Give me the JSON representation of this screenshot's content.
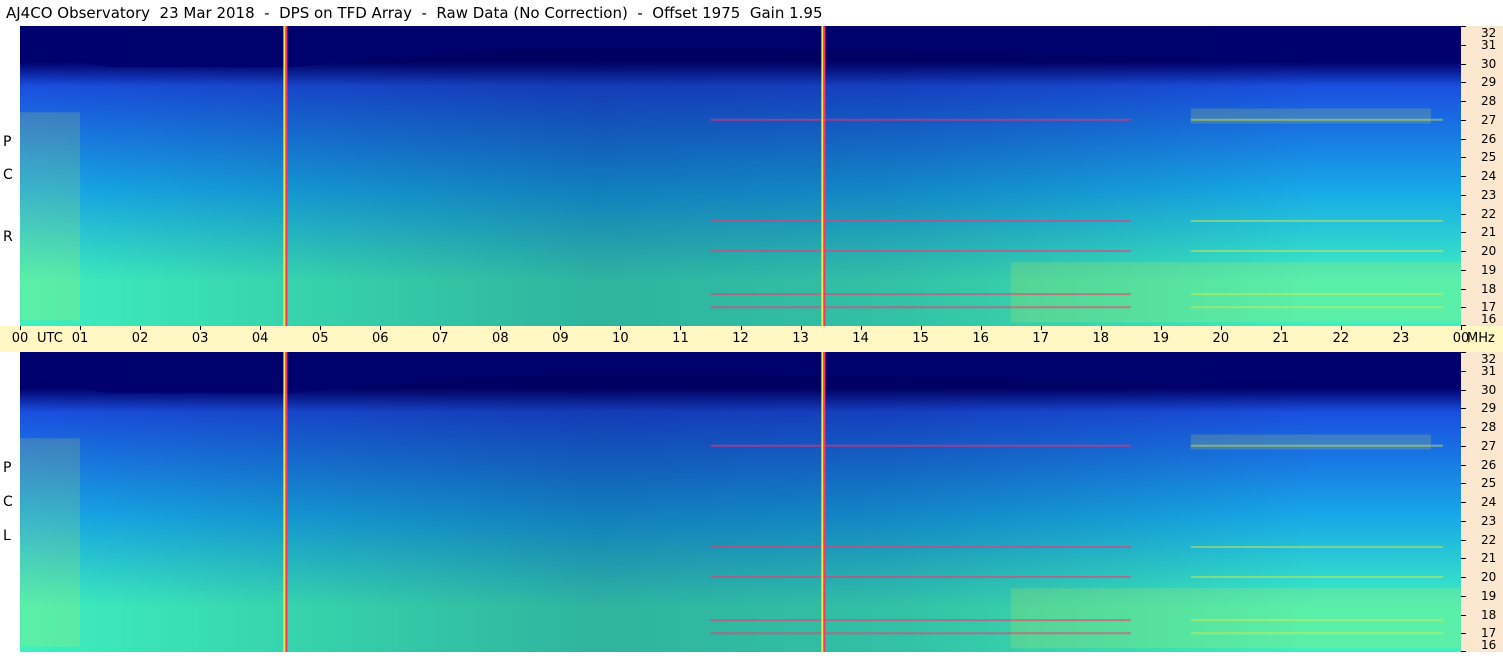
{
  "title": "AJ4CO Observatory  23 Mar 2018  -  DPS on TFD Array  -  Raw Data (No Correction)  -  Offset 1975  Gain 1.95",
  "panels": [
    {
      "id": "rcp",
      "letters": [
        "R",
        "C",
        "P"
      ]
    },
    {
      "id": "lcp",
      "letters": [
        "L",
        "C",
        "P"
      ]
    }
  ],
  "time_axis": {
    "labels": [
      "00",
      "01",
      "02",
      "03",
      "04",
      "05",
      "06",
      "07",
      "08",
      "09",
      "10",
      "11",
      "12",
      "13",
      "14",
      "15",
      "16",
      "17",
      "18",
      "19",
      "20",
      "21",
      "22",
      "23",
      "00"
    ],
    "utc_label": "UTC",
    "unit_label": "MHz"
  },
  "colors": {
    "background_noise": "#00006e",
    "low_signal": "#1a4fe0",
    "mid_signal": "#17a9e8",
    "high_signal": "#3ef0c0",
    "peak_signal": "#e0f040",
    "interference": "#ff3070",
    "time_axis_bg": "#fff7c4",
    "freq_axis_bg": "#fbe6d0"
  },
  "chart_data": {
    "type": "heatmap",
    "title": "AJ4CO Observatory  23 Mar 2018  -  DPS on TFD Array  -  Raw Data (No Correction)  -  Offset 1975  Gain 1.95",
    "xlabel": "UTC",
    "ylabel": "MHz",
    "x_range": [
      0,
      24
    ],
    "y_range": [
      16,
      32
    ],
    "x_ticks": [
      "00",
      "01",
      "02",
      "03",
      "04",
      "05",
      "06",
      "07",
      "08",
      "09",
      "10",
      "11",
      "12",
      "13",
      "14",
      "15",
      "16",
      "17",
      "18",
      "19",
      "20",
      "21",
      "22",
      "23",
      "00"
    ],
    "y_ticks": [
      16,
      17,
      18,
      19,
      20,
      21,
      22,
      23,
      24,
      25,
      26,
      27,
      28,
      29,
      30,
      31,
      32
    ],
    "panels": [
      "RCP",
      "LCP"
    ],
    "vertical_markers_utc": [
      4.42,
      13.38
    ],
    "interference_lines_mhz": [
      17.0,
      17.7,
      20.0,
      21.6,
      27.0
    ]
  }
}
